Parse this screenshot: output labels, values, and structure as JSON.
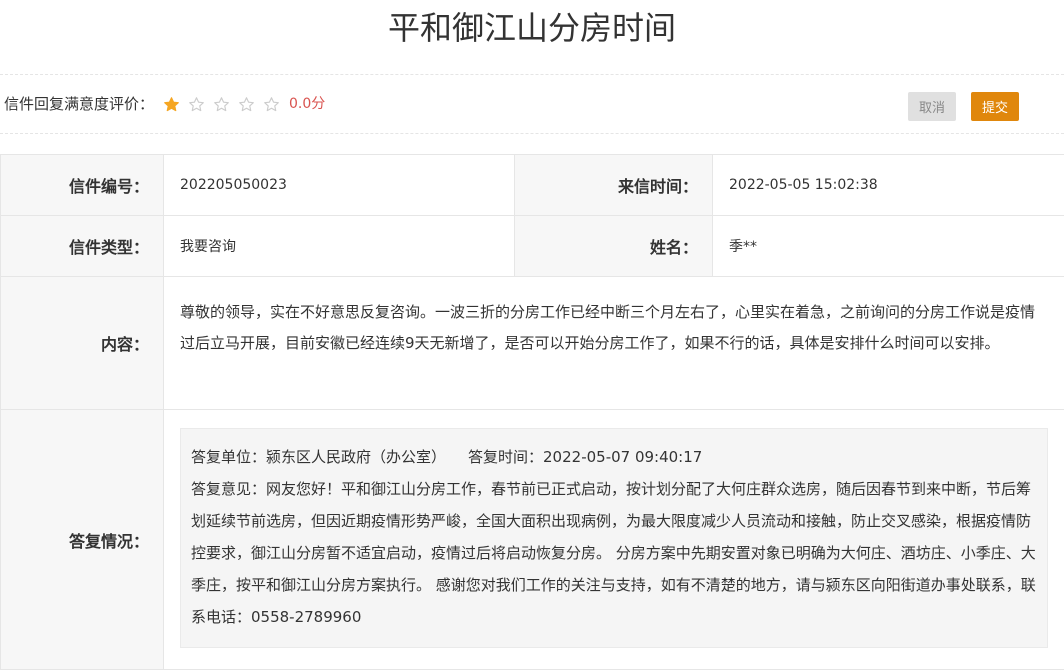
{
  "page": {
    "title": "平和御江山分房时间"
  },
  "rating": {
    "label": "信件回复满意度评价：",
    "stars_total": 5,
    "stars_filled": 1,
    "score": "0.0分",
    "star_filled_color": "#f5a623",
    "star_empty_color": "#cccccc",
    "cancel_label": "取消",
    "submit_label": "提交"
  },
  "letter": {
    "number_label": "信件编号：",
    "number": "202205050023",
    "time_label": "来信时间：",
    "time": "2022-05-05 15:02:38",
    "type_label": "信件类型：",
    "type": "我要咨询",
    "name_label": "姓名：",
    "name": "季**",
    "content_label": "内容：",
    "content": "尊敬的领导，实在不好意思反复咨询。一波三折的分房工作已经中断三个月左右了，心里实在着急，之前询问的分房工作说是疫情过后立马开展，目前安徽已经连续9天无新增了，是否可以开始分房工作了，如果不行的话，具体是安排什么时间可以安排。"
  },
  "reply": {
    "label": "答复情况：",
    "unit": "答复单位：颍东区人民政府（办公室）",
    "time": "答复时间：2022-05-07 09:40:17",
    "opinion": "答复意见：网友您好！平和御江山分房工作，春节前已正式启动，按计划分配了大何庄群众选房，随后因春节到来中断，节后筹划延续节前选房，但因近期疫情形势严峻，全国大面积出现病例，为最大限度减少人员流动和接触，防止交叉感染，根据疫情防控要求，御江山分房暂不适宜启动，疫情过后将启动恢复分房。 分房方案中先期安置对象已明确为大何庄、酒坊庄、小季庄、大季庄，按平和御江山分房方案执行。 感谢您对我们工作的关注与支持，如有不清楚的地方，请与颍东区向阳街道办事处联系，联系电话：0558-2789960"
  }
}
